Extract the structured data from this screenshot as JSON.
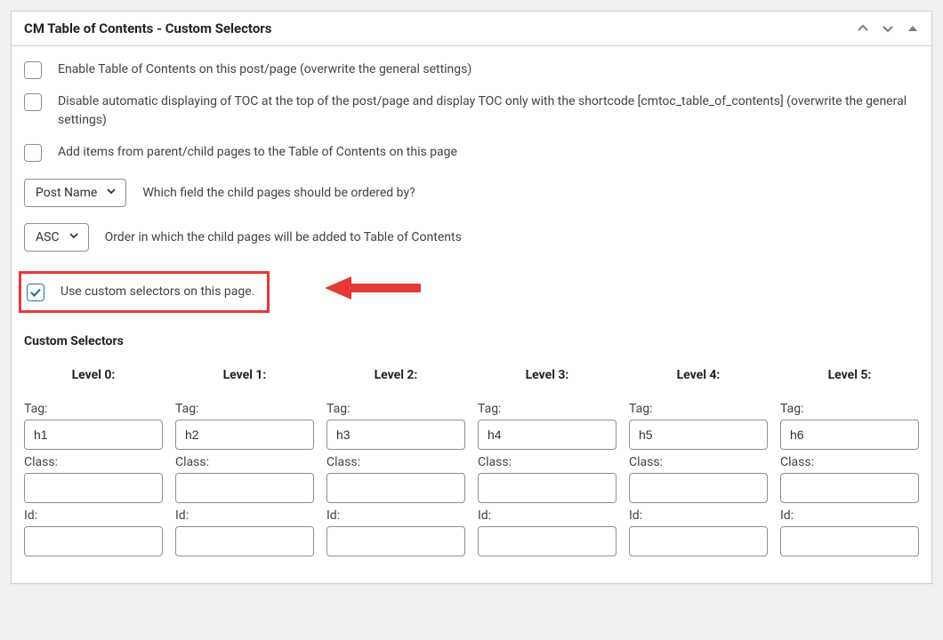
{
  "header": {
    "title": "CM Table of Contents - Custom Selectors"
  },
  "options": {
    "enable_toc_label": "Enable Table of Contents on this post/page (overwrite the general settings)",
    "disable_auto_label": "Disable automatic displaying of TOC at the top of the post/page and display TOC only with the shortcode [cmtoc_table_of_contents] (overwrite the general settings)",
    "add_parent_child_label": "Add items from parent/child pages to the Table of Contents on this page",
    "use_custom_label": "Use custom selectors on this page."
  },
  "orderby": {
    "value": "Post Name",
    "desc": "Which field the child pages should be ordered by?"
  },
  "order": {
    "value": "ASC",
    "desc": "Order in which the child pages will be added to Table of Contents"
  },
  "section_heading": "Custom Selectors",
  "field_labels": {
    "tag": "Tag:",
    "class": "Class:",
    "id": "Id:"
  },
  "levels": [
    {
      "heading": "Level 0:",
      "tag": "h1",
      "class": "",
      "id": ""
    },
    {
      "heading": "Level 1:",
      "tag": "h2",
      "class": "",
      "id": ""
    },
    {
      "heading": "Level 2:",
      "tag": "h3",
      "class": "",
      "id": ""
    },
    {
      "heading": "Level 3:",
      "tag": "h4",
      "class": "",
      "id": ""
    },
    {
      "heading": "Level 4:",
      "tag": "h5",
      "class": "",
      "id": ""
    },
    {
      "heading": "Level 5:",
      "tag": "h6",
      "class": "",
      "id": ""
    }
  ]
}
